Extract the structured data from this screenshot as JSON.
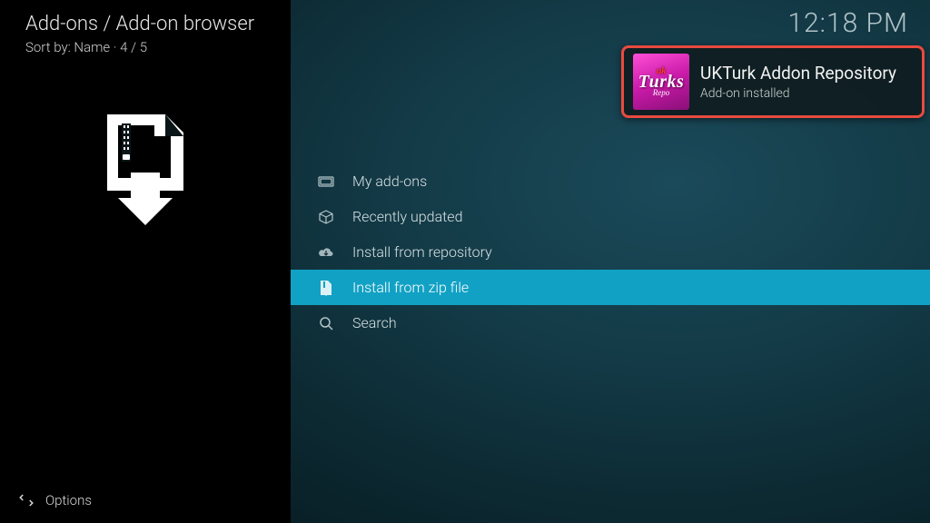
{
  "header": {
    "breadcrumb": "Add-ons / Add-on browser",
    "sort_prefix": "Sort by: ",
    "sort_field": "Name",
    "sort_count": "4 / 5"
  },
  "clock": "12:18 PM",
  "menu": {
    "items": [
      {
        "label": "My add-ons",
        "icon": "addons-icon"
      },
      {
        "label": "Recently updated",
        "icon": "box-icon"
      },
      {
        "label": "Install from repository",
        "icon": "cloud-download-icon"
      },
      {
        "label": "Install from zip file",
        "icon": "zip-file-icon"
      },
      {
        "label": "Search",
        "icon": "search-icon"
      }
    ],
    "selected_index": 3
  },
  "notification": {
    "title": "UKTurk Addon Repository",
    "subtitle": "Add-on installed",
    "thumb": {
      "line1": "uk",
      "line2": "Turks",
      "line3": "Repo"
    }
  },
  "footer": {
    "options_label": "Options"
  }
}
